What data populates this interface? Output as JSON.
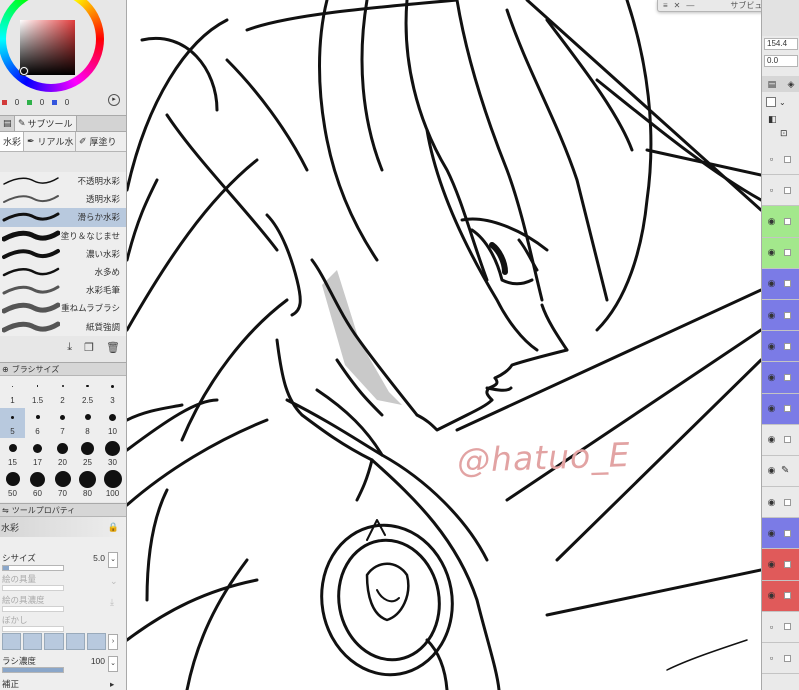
{
  "color": {
    "rgb": [
      {
        "channel": "red",
        "value": "0",
        "swatch": "#d23a3a"
      },
      {
        "channel": "green",
        "value": "0",
        "swatch": "#2fb14a"
      },
      {
        "channel": "blue",
        "value": "0",
        "swatch": "#3355dd"
      }
    ],
    "wheel_selected_hue": "#e23d3d"
  },
  "subtool": {
    "tabs": [
      "サブツール"
    ],
    "groups": [
      {
        "label": "水彩",
        "icon": "watercolor-brush-icon",
        "active": true
      },
      {
        "label": "リアル水",
        "icon": "real-watercolor-icon",
        "active": false
      },
      {
        "label": "厚塗り",
        "icon": "thick-paint-icon",
        "active": false
      }
    ],
    "brushes": [
      {
        "label": "不透明水彩",
        "selected": false
      },
      {
        "label": "透明水彩",
        "selected": false
      },
      {
        "label": "滑らか水彩",
        "selected": true
      },
      {
        "label": "塗り＆なじませ",
        "selected": false
      },
      {
        "label": "濃い水彩",
        "selected": false
      },
      {
        "label": "水多め",
        "selected": false
      },
      {
        "label": "水彩毛筆",
        "selected": false
      },
      {
        "label": "重ねムラブラシ",
        "selected": false
      },
      {
        "label": "紙質強調",
        "selected": false
      }
    ]
  },
  "brush_size": {
    "title": "ブラシサイズ",
    "sizes": [
      [
        "1",
        "1.5",
        "2",
        "2.5",
        "3"
      ],
      [
        "5",
        "6",
        "7",
        "8",
        "10"
      ],
      [
        "15",
        "17",
        "20",
        "25",
        "30"
      ],
      [
        "50",
        "60",
        "70",
        "80",
        "100"
      ]
    ],
    "selected": "5"
  },
  "tool_property": {
    "title": "ツールプロパティ",
    "tool_name": "水彩",
    "brush_size_label": "シサイズ",
    "brush_size_value": "5.0",
    "paint_amount_label": "絵の具量",
    "paint_density_label": "絵の具濃度",
    "blur_label": "ぼかし",
    "brush_density_label": "ラシ濃度",
    "brush_density_value": "100",
    "correction_label": "補正"
  },
  "subview": {
    "title": "サブビュー",
    "close": "✕"
  },
  "watermark": "@hatuo_E",
  "right_panel": {
    "value1": "154.4",
    "value2": "0.0",
    "layers": [
      {
        "color": "",
        "eye": false,
        "pen": false
      },
      {
        "color": "",
        "eye": false,
        "pen": false
      },
      {
        "color": "#a3e88c",
        "eye": true,
        "pen": false
      },
      {
        "color": "#a3e88c",
        "eye": true,
        "pen": false
      },
      {
        "color": "#7b7be6",
        "eye": true,
        "pen": false
      },
      {
        "color": "#7b7be6",
        "eye": true,
        "pen": false
      },
      {
        "color": "#7b7be6",
        "eye": true,
        "pen": false
      },
      {
        "color": "#7b7be6",
        "eye": true,
        "pen": false
      },
      {
        "color": "#7b7be6",
        "eye": true,
        "pen": false
      },
      {
        "color": "",
        "eye": true,
        "pen": false
      },
      {
        "color": "",
        "eye": true,
        "pen": true
      },
      {
        "color": "",
        "eye": true,
        "pen": false
      },
      {
        "color": "#7b7be6",
        "eye": true,
        "pen": false
      },
      {
        "color": "#e05a5a",
        "eye": true,
        "pen": false
      },
      {
        "color": "#e05a5a",
        "eye": true,
        "pen": false
      },
      {
        "color": "",
        "eye": false,
        "pen": false
      },
      {
        "color": "",
        "eye": false,
        "pen": false
      }
    ]
  },
  "accent_selection": "#b8c9de"
}
